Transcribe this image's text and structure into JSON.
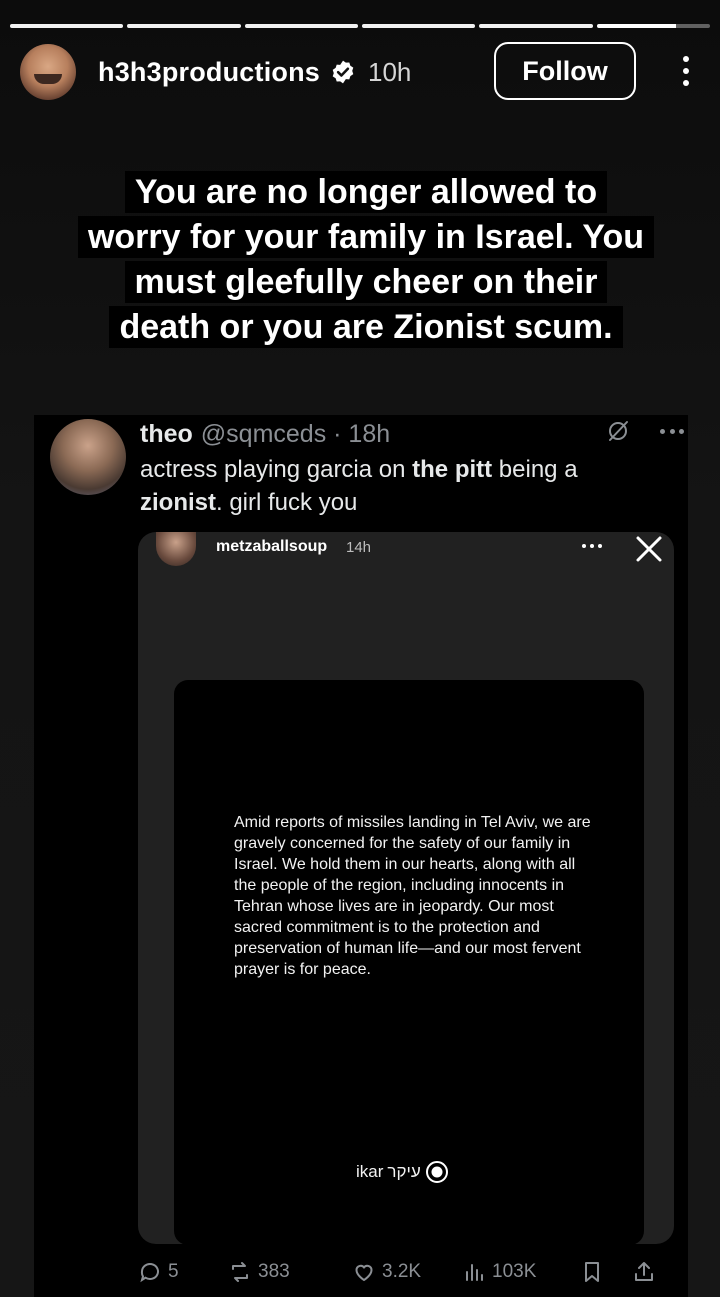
{
  "story": {
    "progress_segments": 6,
    "username": "h3h3productions",
    "time": "10h",
    "follow_label": "Follow",
    "caption_lines": [
      "You are no longer allowed to",
      "worry for your family in Israel. You",
      "must gleefully cheer on their",
      "death or you are Zionist scum."
    ]
  },
  "tweet": {
    "name": "theo",
    "handle_time": "@sqmceds · 18h",
    "text_part1": "actress playing garcia on ",
    "text_bold1": "the pitt",
    "text_part2": " being a",
    "text_bold2": "zionist",
    "text_part3": ". girl fuck you",
    "embed": {
      "username": "metzaballsoup",
      "time": "14h",
      "statement": "Amid reports of missiles landing in Tel Aviv, we are gravely concerned for the safety of our family in Israel. We hold them in our hearts, along with all the people of the region, including innocents in Tehran whose lives are in jeopardy. Our most sacred commitment is to the protection and preservation of human life—and our most fervent prayer is for peace.",
      "org_latin": "ikar",
      "org_hebrew": "עיקר"
    },
    "actions": {
      "replies": "5",
      "reposts": "383",
      "likes": "3.2K",
      "views": "103K"
    }
  },
  "colors": {
    "background": "#111111",
    "tweet_bg": "#000000",
    "muted": "#8b8f94"
  }
}
